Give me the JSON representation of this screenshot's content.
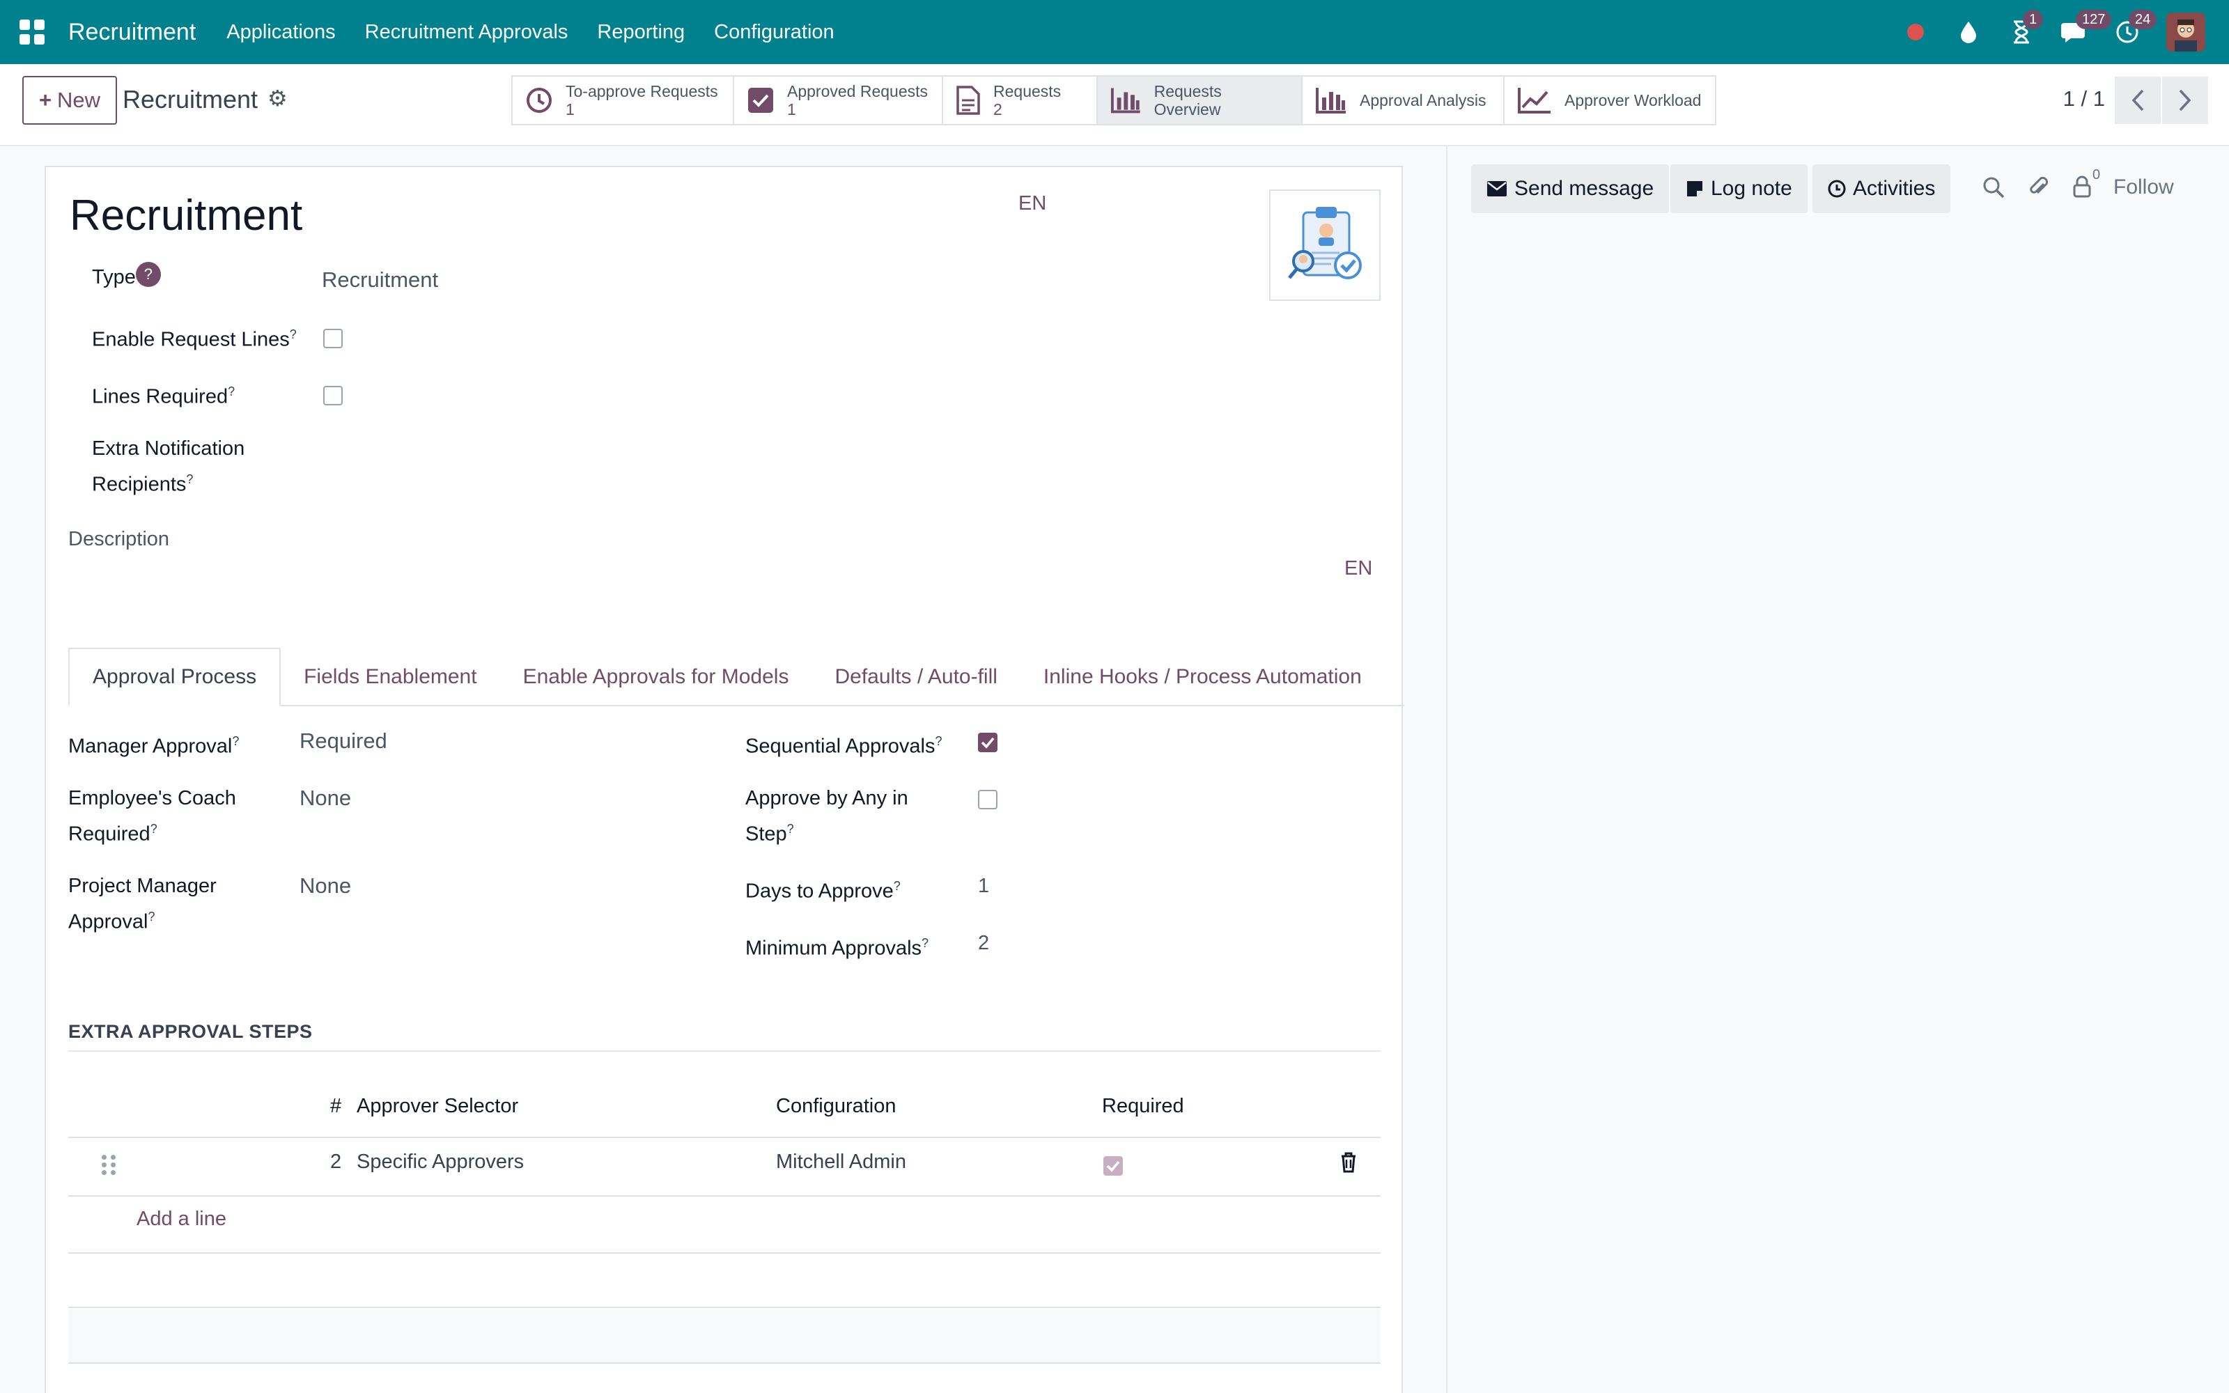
{
  "navbar": {
    "brand": "Recruitment",
    "menus": [
      "Applications",
      "Recruitment Approvals",
      "Reporting",
      "Configuration"
    ],
    "badges": {
      "activities": "1",
      "messages": "127",
      "updates": "24"
    }
  },
  "control": {
    "new_label": "New",
    "breadcrumb": "Recruitment",
    "smart_buttons": [
      {
        "label": "To-approve Requests",
        "count": "1",
        "icon": "clock-icon"
      },
      {
        "label": "Approved Requests",
        "count": "1",
        "icon": "check-square-icon"
      },
      {
        "label": "Requests",
        "count": "2",
        "icon": "document-icon"
      },
      {
        "label": "Requests Overview",
        "count": "",
        "icon": "bar-chart-icon"
      },
      {
        "label": "Approval Analysis",
        "count": "",
        "icon": "bar-chart-icon"
      },
      {
        "label": "Approver Workload",
        "count": "",
        "icon": "line-chart-icon"
      }
    ],
    "pager": "1 / 1"
  },
  "form": {
    "title": "Recruitment",
    "lang": "EN",
    "fields": {
      "type_label": "Type",
      "type_help": "?",
      "type_value": "Recruitment",
      "enable_lines_label": "Enable Request Lines",
      "lines_required_label": "Lines Required",
      "extra_notif_label_1": "Extra Notification",
      "extra_notif_label_2": "Recipients",
      "description_label": "Description",
      "help_mark": "?"
    },
    "tabs": [
      "Approval Process",
      "Fields Enablement",
      "Enable Approvals for Models",
      "Defaults / Auto-fill",
      "Inline Hooks / Process Automation"
    ],
    "approval": {
      "manager_label": "Manager Approval",
      "manager_value": "Required",
      "coach_label_1": "Employee's Coach",
      "coach_label_2": "Required",
      "coach_value": "None",
      "pm_label_1": "Project Manager",
      "pm_label_2": "Approval",
      "pm_value": "None",
      "sequential_label": "Sequential Approvals",
      "sequential_checked": true,
      "any_label_1": "Approve by Any in",
      "any_label_2": "Step",
      "any_checked": false,
      "days_label": "Days to Approve",
      "days_value": "1",
      "min_label": "Minimum Approvals",
      "min_value": "2"
    },
    "extra_steps": {
      "title": "EXTRA APPROVAL STEPS",
      "columns": [
        "#",
        "Approver Selector",
        "Configuration",
        "Required"
      ],
      "rows": [
        {
          "num": "2",
          "selector": "Specific Approvers",
          "configuration": "Mitchell Admin",
          "required": true
        }
      ],
      "add_line": "Add a line"
    }
  },
  "chatter": {
    "send_message": "Send message",
    "log_note": "Log note",
    "activities": "Activities",
    "followers_count": "0",
    "follow": "Follow"
  }
}
